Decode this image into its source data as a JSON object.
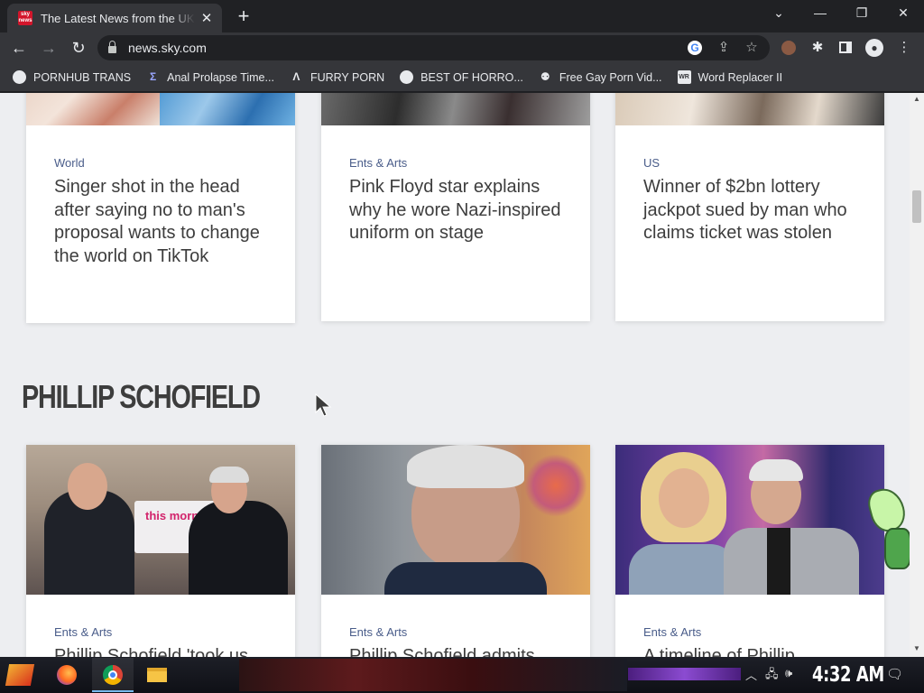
{
  "tab": {
    "favicon_text": "sky news",
    "title": "The Latest News from the UK and Around the World",
    "close": "✕",
    "new_tab": "+"
  },
  "window_controls": {
    "chevron": "⌄",
    "minimize": "—",
    "restore": "❐",
    "close": "✕"
  },
  "toolbar": {
    "back": "←",
    "forward": "→",
    "reload": "↻",
    "url": "news.sky.com"
  },
  "bookmarks": [
    {
      "label": "PORNHUB TRANS",
      "icon": "globe-icon"
    },
    {
      "label": "Anal Prolapse Time...",
      "icon": "bookmark-icon"
    },
    {
      "label": "FURRY PORN",
      "icon": "lambda-icon"
    },
    {
      "label": "BEST OF HORRO...",
      "icon": "globe-icon"
    },
    {
      "label": "Free Gay Porn Vid...",
      "icon": "site-icon"
    },
    {
      "label": "Word Replacer II",
      "icon": "extension-icon"
    }
  ],
  "cards_top": [
    {
      "category": "World",
      "title": "Singer shot in the head after saying no to man's proposal wants to change the world on TikTok"
    },
    {
      "category": "Ents & Arts",
      "title": "Pink Floyd star explains why he wore Nazi-inspired uniform on stage"
    },
    {
      "category": "US",
      "title": "Winner of $2bn lottery jackpot sued by man who claims ticket was stolen"
    }
  ],
  "section": {
    "title": "PHILLIP SCHOFIELD"
  },
  "cards_bottom": [
    {
      "category": "Ents & Arts",
      "title": "Phillip Schofield 'took us",
      "image_text": "this morning"
    },
    {
      "category": "Ents & Arts",
      "title": "Phillip Schofield admits"
    },
    {
      "category": "Ents & Arts",
      "title": "A timeline of Phillip"
    }
  ],
  "taskbar": {
    "clock": "4:32 AM",
    "tray_chevron": "︿"
  },
  "colors": {
    "category": "#4a5d8a",
    "page_bg": "#edeef1",
    "chrome_dark": "#202124",
    "chrome_toolbar": "#35363a"
  }
}
